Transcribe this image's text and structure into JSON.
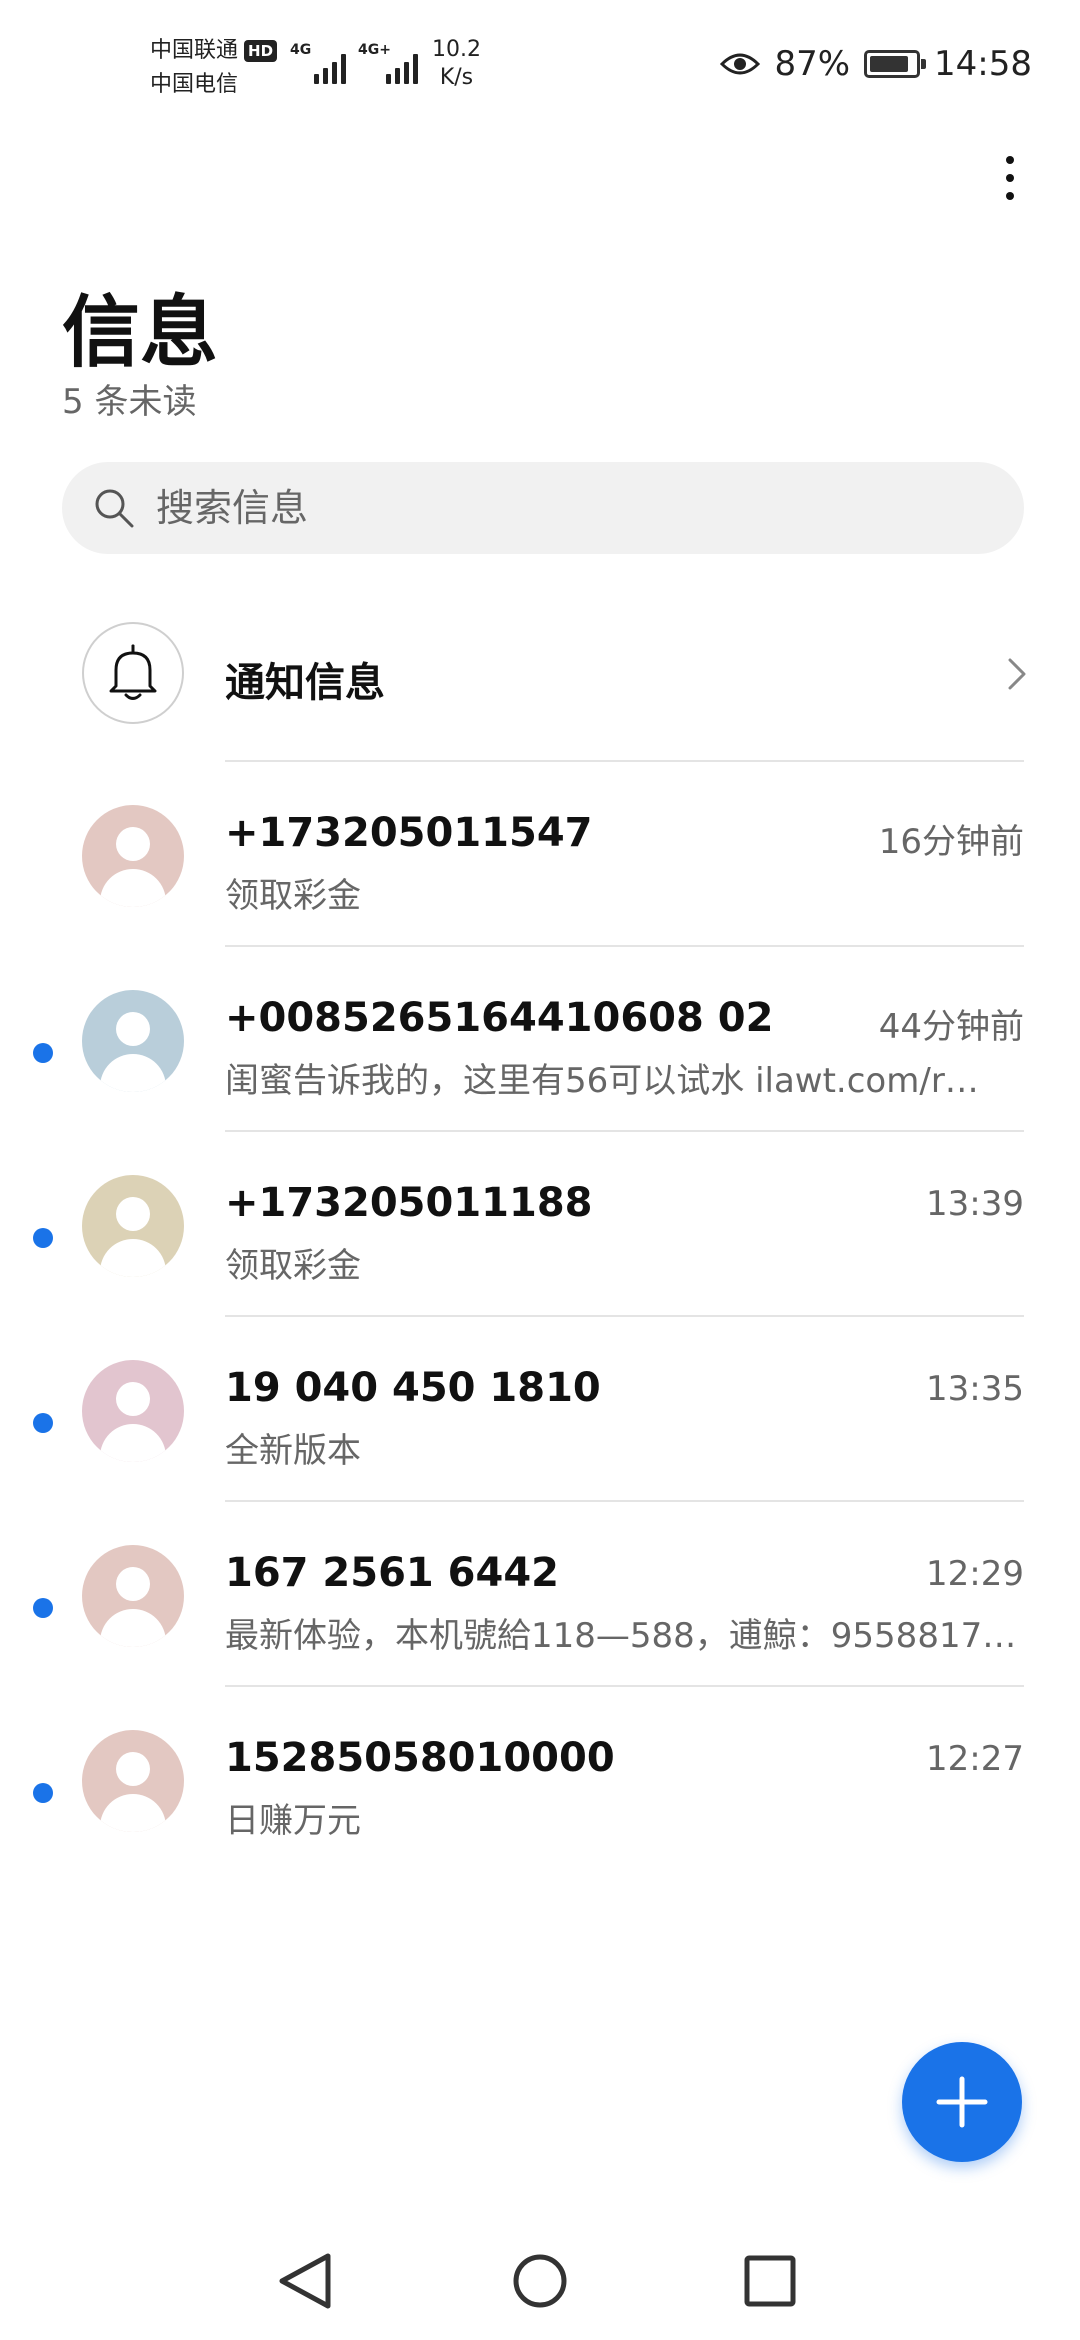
{
  "status_bar": {
    "carrier_1": "中国联通",
    "carrier_1_badge": "HD",
    "carrier_2": "中国电信",
    "network_1": "4G",
    "network_2": "4G+",
    "speed_value": "10.2",
    "speed_unit": "K/s",
    "battery_percent": "87%",
    "battery_level": 0.87,
    "time": "14:58"
  },
  "header": {
    "title": "信息",
    "unread_summary": "5 条未读"
  },
  "search": {
    "placeholder": "搜索信息"
  },
  "notification_entry": {
    "label": "通知信息"
  },
  "messages": [
    {
      "sender": "+173205011547",
      "time": "16分钟前",
      "preview": "领取彩金",
      "unread": false,
      "avatar_color": "#e3c8c2"
    },
    {
      "sender": "+0085265164410608 02",
      "time": "44分钟前",
      "preview": "闺蜜告诉我的，这里有56可以试水 ilawt.com/r…",
      "unread": true,
      "avatar_color": "#b9ceda"
    },
    {
      "sender": "+173205011188",
      "time": "13:39",
      "preview": "领取彩金",
      "unread": true,
      "avatar_color": "#dcd2b6"
    },
    {
      "sender": "19 040 450 1810",
      "time": "13:35",
      "preview": "全新版本",
      "unread": true,
      "avatar_color": "#e2c5cf"
    },
    {
      "sender": "167 2561 6442",
      "time": "12:29",
      "preview": "最新体验，本机號給118—588，逋鯨：9558817…",
      "unread": true,
      "avatar_color": "#e3c8c2"
    },
    {
      "sender": "15285058010000",
      "time": "12:27",
      "preview": "日赚万元",
      "unread": true,
      "avatar_color": "#e3c8c2"
    }
  ],
  "colors": {
    "accent": "#1a73e8",
    "secondary_text": "#666666",
    "search_bg": "#f1f1f1"
  },
  "icons": {
    "more": "more-vertical-icon",
    "search": "search-icon",
    "bell": "bell-icon",
    "chevron": "chevron-right-icon",
    "fab": "plus-icon",
    "nav_back": "triangle-back-icon",
    "nav_home": "circle-home-icon",
    "nav_recents": "square-recents-icon"
  }
}
